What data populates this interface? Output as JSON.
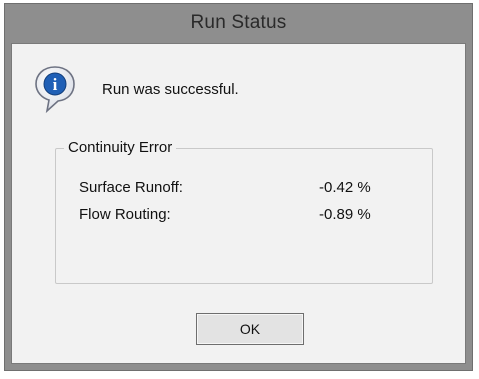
{
  "window": {
    "title": "Run Status"
  },
  "message": {
    "icon": "info-icon",
    "text": "Run was successful."
  },
  "continuity": {
    "legend": "Continuity Error",
    "rows": [
      {
        "label": "Surface Runoff:",
        "value": "-0.42 %"
      },
      {
        "label": "Flow Routing:",
        "value": "-0.89 %"
      }
    ]
  },
  "buttons": {
    "ok_label": "OK"
  },
  "colors": {
    "frame": "#8e8e8e",
    "client": "#f2f2f2",
    "icon_blue": "#1f5fb6"
  }
}
